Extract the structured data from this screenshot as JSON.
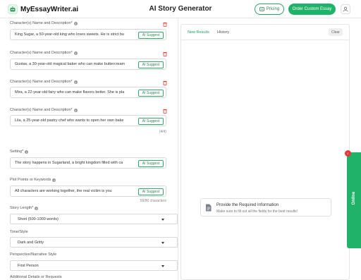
{
  "header": {
    "logo_text": "MyEssayWriter.ai",
    "title": "AI Story Generator",
    "pricing_label": "Pricing",
    "order_label": "Order Custom Essay"
  },
  "characters": [
    {
      "label": "Character(s) Name and Description*",
      "value": "King Sugar, a 50-year-old king who loves sweets. He is strict bu",
      "ai": "AI Suggest"
    },
    {
      "label": "Character(s) Name and Description*",
      "value": "Gustav, a 30-year-old magical baker who can make buttercream",
      "ai": "AI Suggest"
    },
    {
      "label": "Character(s) Name and Description*",
      "value": "Mira, a 22-year-old fairy who can make flavors better. She is pla",
      "ai": "AI Suggest"
    },
    {
      "label": "Character(s) Name and Description*",
      "value": "Lila, a 25-year-old pastry chef who wants to open her own bake",
      "ai": "AI Suggest"
    }
  ],
  "characters_count": "(4/4)",
  "setting": {
    "label": "Setting*",
    "value": "The story happens in Sugarland, a bright kingdom filled with ca",
    "ai": "AI Suggest"
  },
  "plot": {
    "label": "Plot Points or Keywords",
    "value": "All characters are working together, the real victim is you",
    "ai": "AI Suggest",
    "counter": "59/80 characters"
  },
  "story_length": {
    "label": "Story Length*",
    "value": "Short (500-1000 words)"
  },
  "tone": {
    "label": "Tone/Style",
    "value": "Dark and Gritty"
  },
  "perspective": {
    "label": "Perspective/Narrative Style",
    "value": "First Person"
  },
  "additional": {
    "label": "Additional Details or Requests"
  },
  "results": {
    "tab_new": "New Results",
    "tab_history": "History",
    "clear_label": "Clear",
    "empty_title": "Provide the Required Information",
    "empty_sub": "Make sure to fill out all the fields for the best results!"
  },
  "online": {
    "label": "Online",
    "badge": "1"
  },
  "colors": {
    "accent": "#1fb36a",
    "danger": "#e53935"
  }
}
